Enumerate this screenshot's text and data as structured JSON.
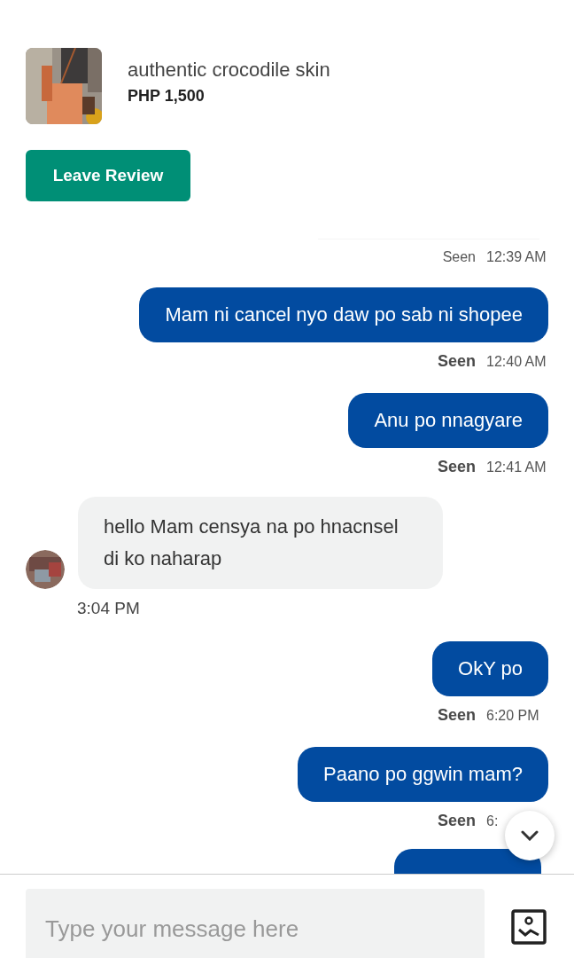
{
  "product": {
    "name": "authentic crocodile skin",
    "price": "PHP 1,500",
    "kind": "picture"
  },
  "review_button": "Leave Review",
  "messages": [
    {
      "kind": "status",
      "seen": "Seen",
      "time": "12:39 AM",
      "emphasized": false
    },
    {
      "kind": "sent",
      "text": "Mam ni cancel nyo daw po sab ni shopee",
      "seen": "Seen",
      "time": "12:40 AM",
      "emphasized": true
    },
    {
      "kind": "sent",
      "text": "Anu po nnagyare",
      "seen": "Seen",
      "time": "12:41 AM",
      "emphasized": true
    },
    {
      "kind": "received",
      "text": "hello Mam censya na po hnacnsel di ko naharap",
      "time": "3:04 PM"
    },
    {
      "kind": "sent",
      "text": "OkY po",
      "seen": "Seen",
      "time": "6:20 PM",
      "emphasized": true
    },
    {
      "kind": "sent",
      "text": "Paano po ggwin mam?",
      "seen": "Seen",
      "time": "6:",
      "emphasized": true
    },
    {
      "kind": "clipped"
    }
  ],
  "composer": {
    "placeholder": "Type your message here"
  }
}
